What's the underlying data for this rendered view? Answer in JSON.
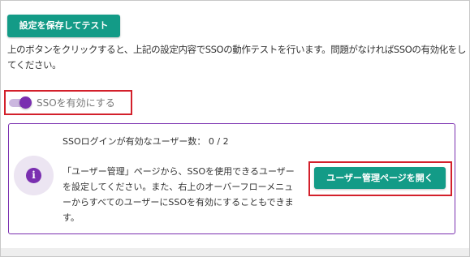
{
  "actions": {
    "save_test_label": "設定を保存してテスト"
  },
  "description": "上のボタンをクリックすると、上記の設定内容でSSOの動作テストを行います。問題がなければSSOの有効化をしてください。",
  "sso_toggle": {
    "label": "SSOを有効にする",
    "checked": true
  },
  "info_panel": {
    "count_label": "SSOログインが有効なユーザー数：",
    "count_value": "0 / 2",
    "icon": "info-icon",
    "message": "「ユーザー管理」ページから、SSOを使用できるユーザーを設定してください。また、右上のオーバーフローメニューからすべてのユーザーにSSOを有効にすることもできます。",
    "open_button_label": "ユーザー管理ページを開く"
  },
  "colors": {
    "primary_button": "#139b87",
    "accent_purple": "#7a2fb0",
    "highlight_red": "#d3202b"
  }
}
